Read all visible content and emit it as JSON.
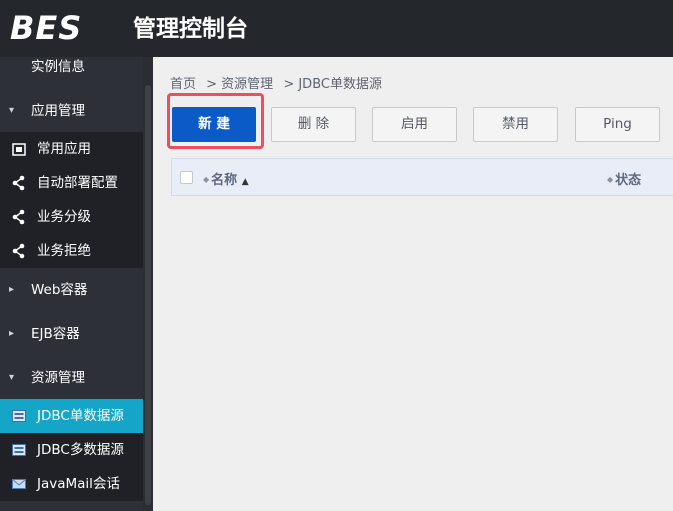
{
  "header": {
    "logo": "BES",
    "title": "管理控制台"
  },
  "sidebar": {
    "items": [
      {
        "label": "实例信息",
        "kind": "group"
      },
      {
        "label": "应用管理",
        "kind": "group",
        "arrow": "▾"
      },
      {
        "label": "常用应用",
        "kind": "sub",
        "icon": "app-icon"
      },
      {
        "label": "自动部署配置",
        "kind": "sub",
        "icon": "share-icon"
      },
      {
        "label": "业务分级",
        "kind": "sub",
        "icon": "share-icon"
      },
      {
        "label": "业务拒绝",
        "kind": "sub",
        "icon": "share-icon"
      },
      {
        "label": "Web容器",
        "kind": "group",
        "arrow": "▸"
      },
      {
        "label": "EJB容器",
        "kind": "group",
        "arrow": "▸"
      },
      {
        "label": "资源管理",
        "kind": "group",
        "arrow": "▾"
      },
      {
        "label": "JDBC单数据源",
        "kind": "sub",
        "icon": "database-icon",
        "active": true
      },
      {
        "label": "JDBC多数据源",
        "kind": "sub",
        "icon": "database-icon"
      },
      {
        "label": "JavaMail会话",
        "kind": "sub",
        "icon": "mail-icon"
      }
    ]
  },
  "breadcrumb": [
    "首页",
    "> 资源管理",
    "> JDBC单数据源"
  ],
  "toolbar": {
    "new_label": "新 建",
    "delete_label": "删 除",
    "enable_label": "启用",
    "disable_label": "禁用",
    "ping_label": "Ping"
  },
  "table": {
    "columns": [
      {
        "label": "名称",
        "sorted": "▲"
      },
      {
        "label": "状态"
      }
    ]
  },
  "colors": {
    "header": "#24272c",
    "sidebar": "#2d3037",
    "active": "#14a5c8",
    "primary": "#0a5bc8",
    "highlight": "#ee4f5f"
  }
}
